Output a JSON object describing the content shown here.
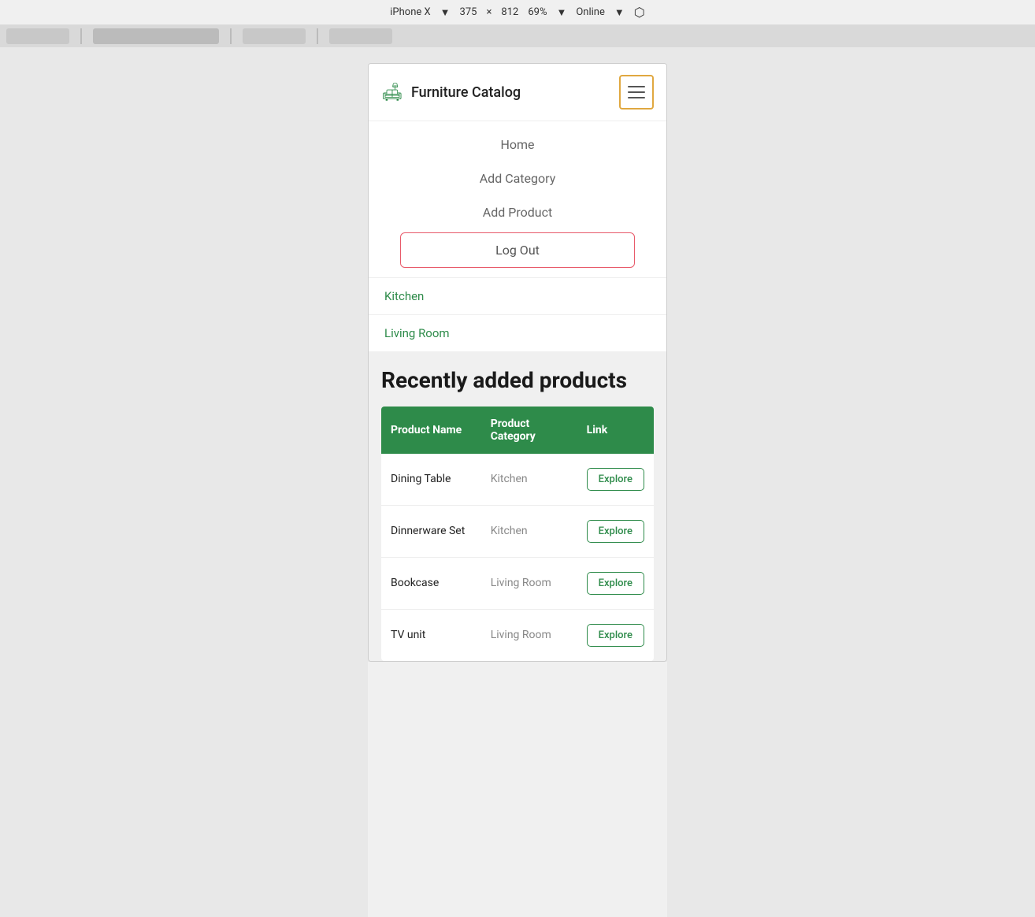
{
  "browser": {
    "device": "iPhone X",
    "width": "375",
    "height": "812",
    "zoom": "69%",
    "network": "Online",
    "separator": "×"
  },
  "navbar": {
    "brand_icon": "🛋",
    "brand_text": "Furniture Catalog",
    "hamburger_label": "Toggle navigation"
  },
  "dropdown": {
    "items": [
      {
        "label": "Home",
        "type": "link"
      },
      {
        "label": "Add Category",
        "type": "link"
      },
      {
        "label": "Add Product",
        "type": "link"
      },
      {
        "label": "Log Out",
        "type": "logout"
      }
    ]
  },
  "categories": [
    {
      "label": "Kitchen"
    },
    {
      "label": "Living Room"
    }
  ],
  "recently_section": {
    "title": "Recently added products"
  },
  "table": {
    "headers": [
      "Product Name",
      "Product Category",
      "Link"
    ],
    "explore_label": "Explore",
    "rows": [
      {
        "name": "Dining Table",
        "category": "Kitchen"
      },
      {
        "name": "Dinnerware Set",
        "category": "Kitchen"
      },
      {
        "name": "Bookcase",
        "category": "Living Room"
      },
      {
        "name": "TV unit",
        "category": "Living Room"
      }
    ]
  }
}
